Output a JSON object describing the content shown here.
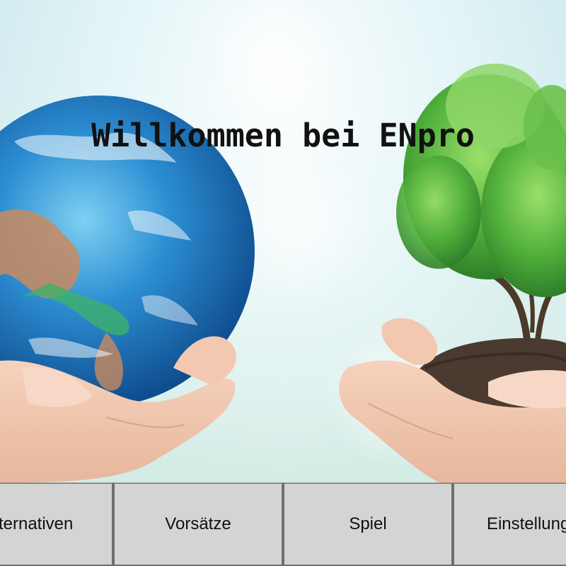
{
  "header": {
    "title": "Willkommen bei ENpro"
  },
  "nav": {
    "buttons": [
      {
        "label": "Alternativen"
      },
      {
        "label": "Vorsätze"
      },
      {
        "label": "Spiel"
      },
      {
        "label": "Einstellungen"
      }
    ]
  },
  "hero": {
    "left_image": "earth-in-hands",
    "right_image": "tree-in-soil-in-hands"
  },
  "colors": {
    "button_bg": "#d4d4d4",
    "button_border": "#6e6e6e",
    "title_color": "#111111"
  }
}
